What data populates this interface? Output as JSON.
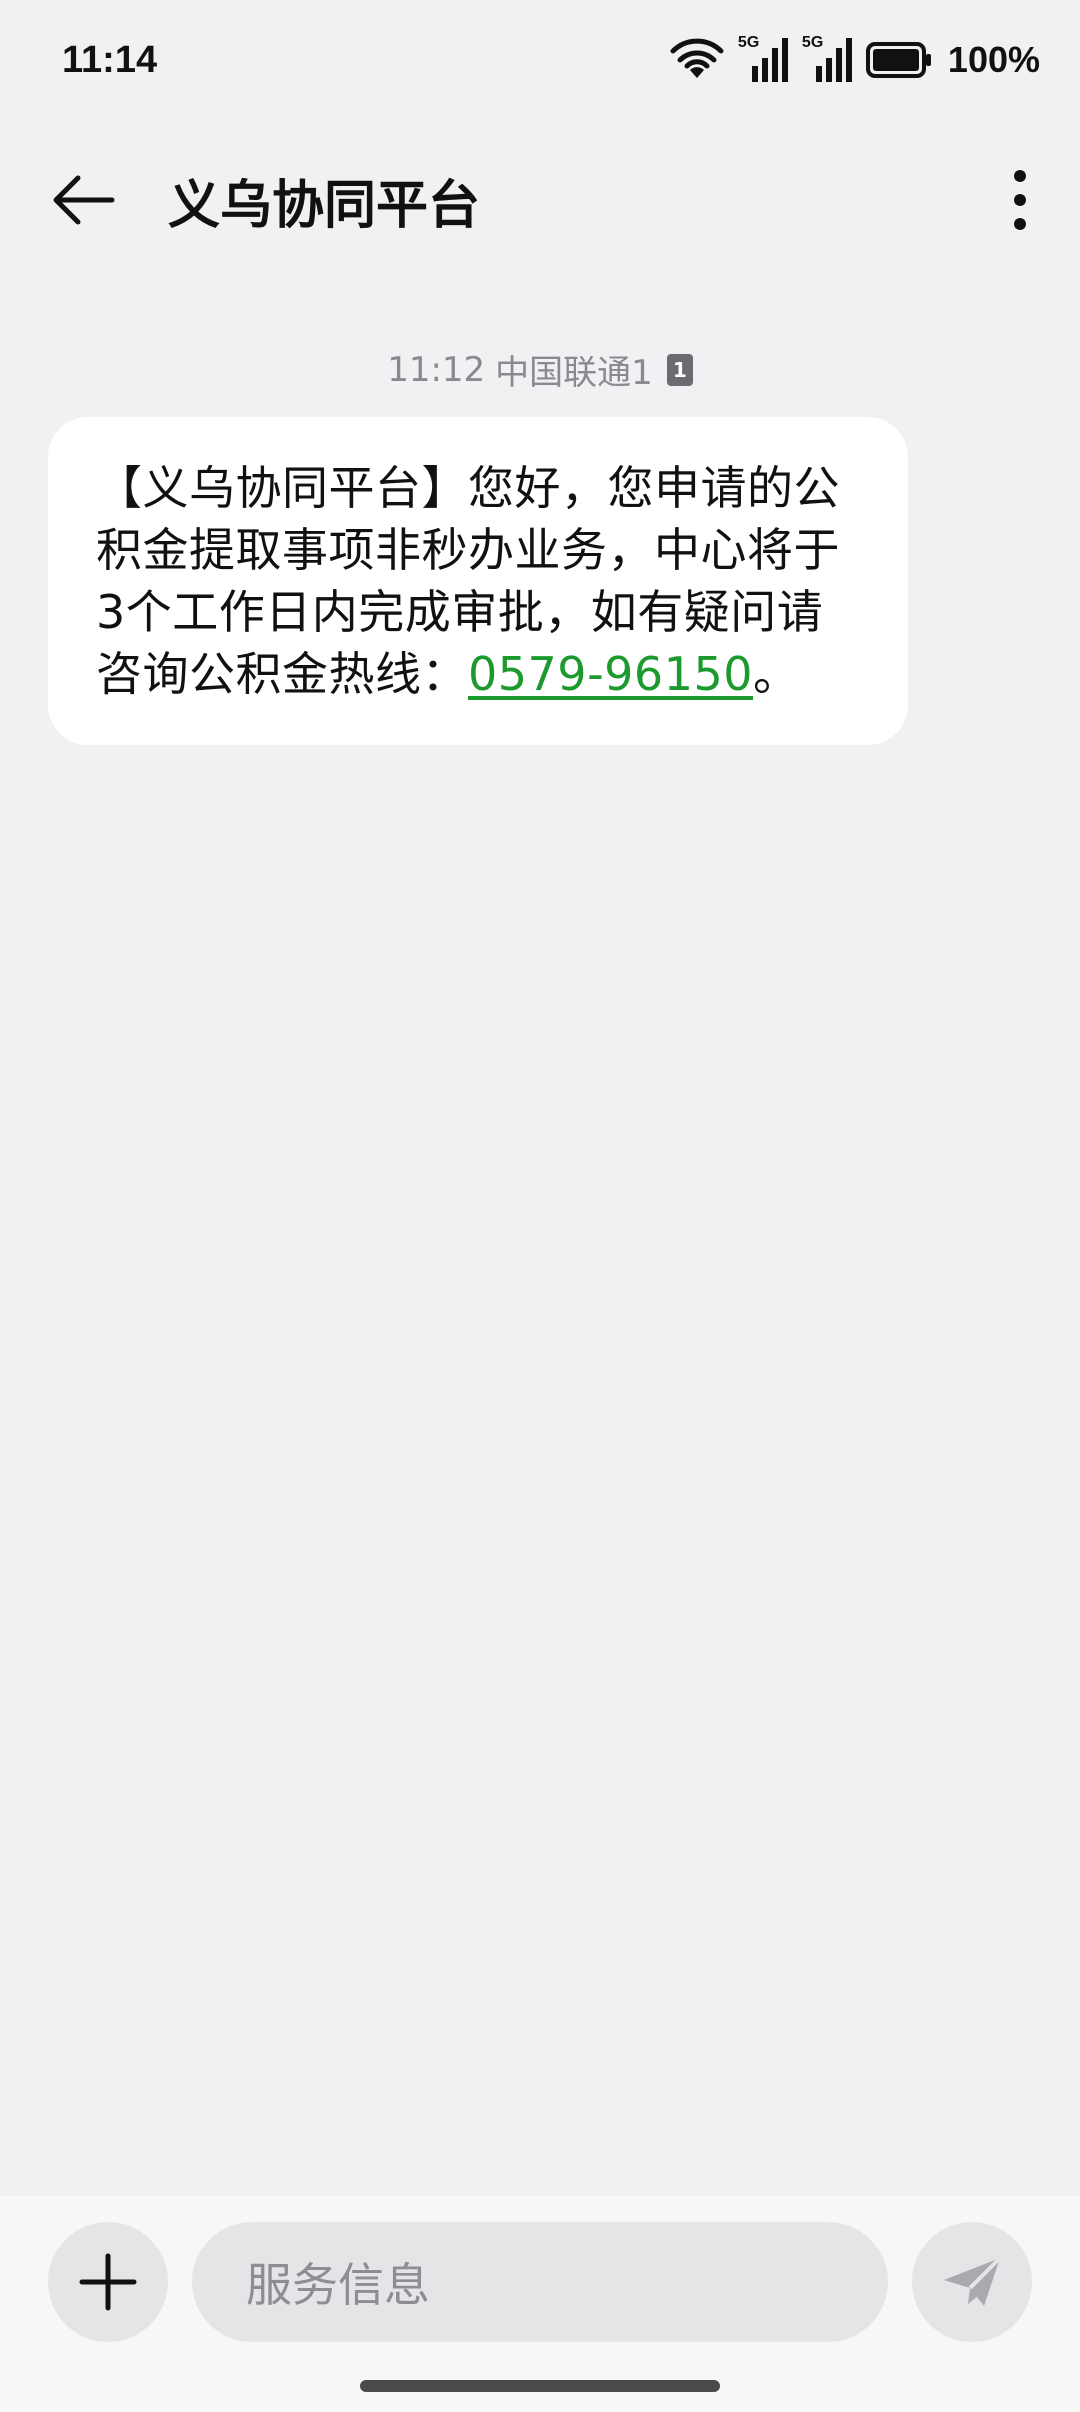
{
  "status_bar": {
    "time": "11:14",
    "signal1_label": "5G",
    "signal2_label": "5G",
    "battery_percent": "100%"
  },
  "header": {
    "title": "义乌协同平台"
  },
  "message": {
    "time": "11:12",
    "carrier": "中国联通1",
    "sim_badge": "1",
    "body_text": "【义乌协同平台】您好，您申请的公积金提取事项非秒办业务，中心将于3个工作日内完成审批，如有疑问请咨询公积金热线：",
    "phone": "0579-96150",
    "trailing": "。"
  },
  "input_bar": {
    "placeholder": "服务信息"
  },
  "colors": {
    "background": "#f0f1f3",
    "bubble": "#ffffff",
    "link": "#1d9a2e"
  }
}
